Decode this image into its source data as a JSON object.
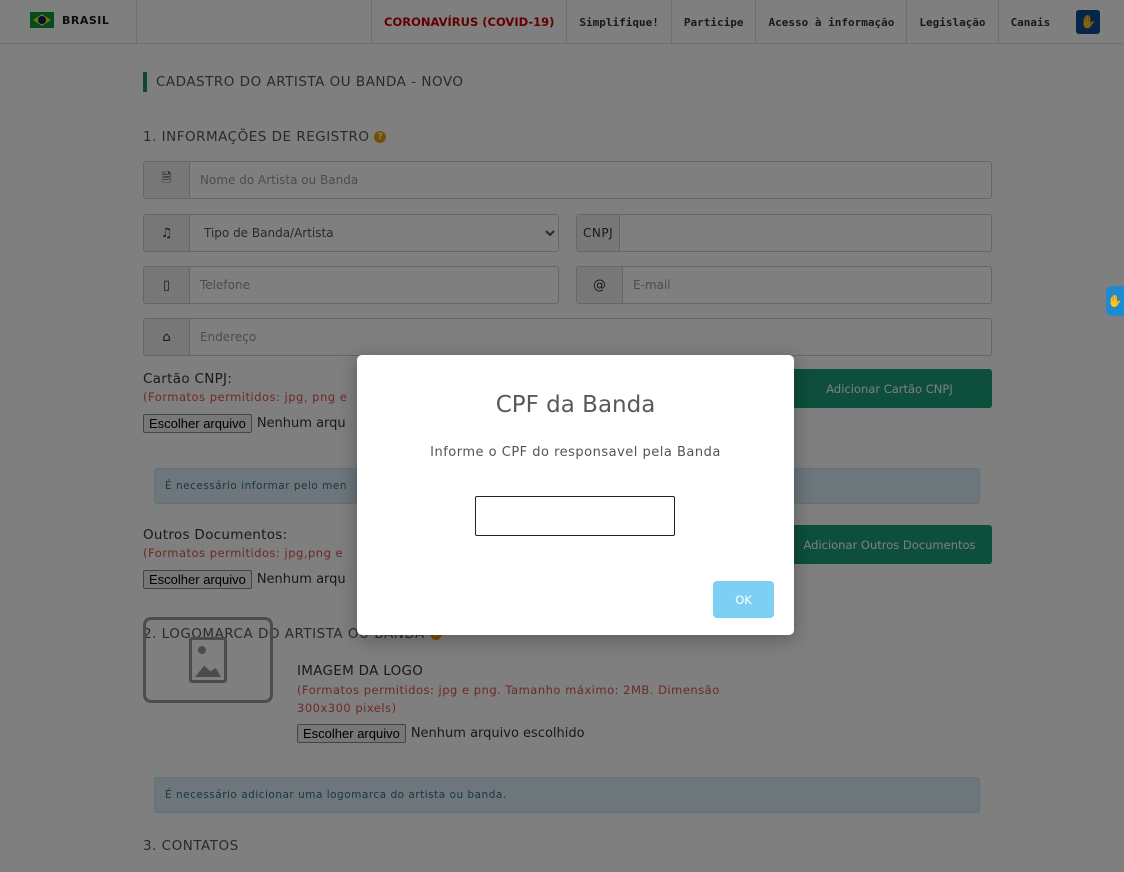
{
  "govbar": {
    "country": "BRASIL",
    "nav": [
      "CORONAVÍRUS (COVID-19)",
      "Simplifique!",
      "Participe",
      "Acesso à informação",
      "Legislação",
      "Canais"
    ]
  },
  "page_title": "CADASTRO DO ARTISTA OU BANDA - NOVO",
  "section1": {
    "title": "1. INFORMAÇÕES DE REGISTRO",
    "name_placeholder": "Nome do Artista ou Banda",
    "type_select": "Tipo de Banda/Artista",
    "cnpj_label": "CNPJ",
    "phone_placeholder": "Telefone",
    "email_addon": "@",
    "email_placeholder": "E-mail",
    "address_placeholder": "Endereço"
  },
  "cartao_cnpj": {
    "label": "Cartão CNPJ:",
    "formats": "(Formatos permitidos: jpg, png e",
    "file_button": "Escolher arquivo",
    "file_status": "Nenhum arqu",
    "add_button": "Adicionar Cartão CNPJ",
    "alert": "É necessário informar pelo men"
  },
  "outros_docs": {
    "label": "Outros Documentos:",
    "formats": "(Formatos permitidos: jpg,png e",
    "file_button": "Escolher arquivo",
    "file_status": "Nenhum arqu",
    "add_button": "Adicionar Outros Documentos"
  },
  "section2": {
    "title": "2. LOGOMARCA DO ARTISTA OU BANDA",
    "logo_label": "IMAGEM DA LOGO",
    "logo_formats_line1": "(Formatos permitidos: jpg e png. Tamanho máximo: 2MB. Dimensão",
    "logo_formats_line2": "300x300 pixels)",
    "file_button": "Escolher arquivo",
    "file_status": "Nenhum arquivo escolhido",
    "alert": "É necessário adicionar uma logomarca do artista ou banda."
  },
  "section3": {
    "title": "3. CONTATOS"
  },
  "modal": {
    "title": "CPF da Banda",
    "text": "Informe o CPF do responsavel pela Banda",
    "input_value": "",
    "ok_label": "OK"
  },
  "colors": {
    "accent_green": "#1a9e78",
    "covid_red": "#c50000",
    "ok_button": "#7ecff4"
  }
}
